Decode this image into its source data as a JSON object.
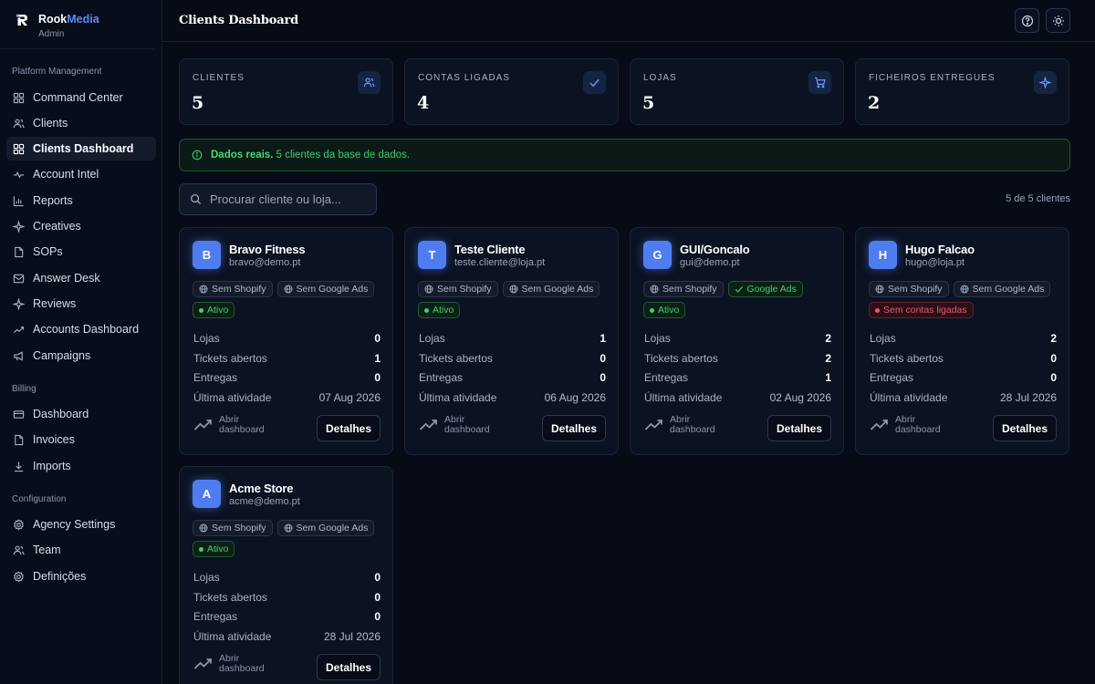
{
  "brand": {
    "name_part1": "Rook",
    "name_part2": "Media",
    "role": "Admin"
  },
  "sidebar": {
    "sections": [
      {
        "label": "Platform Management"
      },
      {
        "label": "Billing"
      },
      {
        "label": "Configuration"
      }
    ],
    "items": [
      {
        "label": "Command Center",
        "icon": "grid-icon"
      },
      {
        "label": "Clients",
        "icon": "users-icon"
      },
      {
        "label": "Clients Dashboard",
        "icon": "grid-icon",
        "active": true
      },
      {
        "label": "Account Intel",
        "icon": "pulse-icon"
      },
      {
        "label": "Reports",
        "icon": "bar-chart-icon"
      },
      {
        "label": "Creatives",
        "icon": "sparkle-icon"
      },
      {
        "label": "SOPs",
        "icon": "document-icon"
      },
      {
        "label": "Answer Desk",
        "icon": "inbox-icon"
      },
      {
        "label": "Reviews",
        "icon": "sparkle-icon"
      },
      {
        "label": "Accounts Dashboard",
        "icon": "trend-icon"
      },
      {
        "label": "Campaigns",
        "icon": "megaphone-icon"
      },
      {
        "label": "Dashboard",
        "icon": "card-icon"
      },
      {
        "label": "Invoices",
        "icon": "document-icon"
      },
      {
        "label": "Imports",
        "icon": "download-icon"
      },
      {
        "label": "Agency Settings",
        "icon": "gear-icon"
      },
      {
        "label": "Team",
        "icon": "users-icon"
      },
      {
        "label": "Definições",
        "icon": "gear-icon"
      }
    ]
  },
  "header": {
    "title": "Clients Dashboard"
  },
  "stats": [
    {
      "label": "CLIENTES",
      "value": "5",
      "icon": "users-icon"
    },
    {
      "label": "CONTAS LIGADAS",
      "value": "4",
      "icon": "check-icon"
    },
    {
      "label": "LOJAS",
      "value": "5",
      "icon": "cart-icon"
    },
    {
      "label": "FICHEIROS ENTREGUES",
      "value": "2",
      "icon": "sparkle-icon"
    }
  ],
  "alert": {
    "bold": "Dados reais.",
    "text": "5 clientes da base de dados."
  },
  "search": {
    "placeholder": "Procurar cliente ou loja..."
  },
  "count": "5 de 5 clientes",
  "labels": {
    "stores": "Lojas",
    "tickets": "Tickets abertos",
    "deliveries": "Entregas",
    "last_activity": "Última atividade",
    "open_dashboard_1": "Abrir",
    "open_dashboard_2": "dashboard",
    "details": "Detalhes"
  },
  "colors": {
    "accent": "#4f7df0",
    "success": "#42d06d",
    "danger": "#f0566a",
    "background": "#060b16"
  },
  "clients": [
    {
      "initial": "B",
      "name": "Bravo Fitness",
      "email": "bravo@demo.pt",
      "shopify": "Sem Shopify",
      "google": "Sem Google Ads",
      "google_connected": false,
      "status": "Ativo",
      "status_type": "ok",
      "stores": "0",
      "tickets": "1",
      "deliveries": "0",
      "last_activity": "07 Aug 2026"
    },
    {
      "initial": "T",
      "name": "Teste Cliente",
      "email": "teste.cliente@loja.pt",
      "shopify": "Sem Shopify",
      "google": "Sem Google Ads",
      "google_connected": false,
      "status": "Ativo",
      "status_type": "ok",
      "stores": "1",
      "tickets": "0",
      "deliveries": "0",
      "last_activity": "06 Aug 2026"
    },
    {
      "initial": "G",
      "name": "GUI/Goncalo",
      "email": "gui@demo.pt",
      "shopify": "Sem Shopify",
      "google": "Google Ads",
      "google_connected": true,
      "status": "Ativo",
      "status_type": "ok",
      "stores": "2",
      "tickets": "2",
      "deliveries": "1",
      "last_activity": "02 Aug 2026"
    },
    {
      "initial": "H",
      "name": "Hugo Falcao",
      "email": "hugo@loja.pt",
      "shopify": "Sem Shopify",
      "google": "Sem Google Ads",
      "google_connected": false,
      "status": "Sem contas ligadas",
      "status_type": "error",
      "stores": "2",
      "tickets": "0",
      "deliveries": "0",
      "last_activity": "28 Jul 2026"
    },
    {
      "initial": "A",
      "name": "Acme Store",
      "email": "acme@demo.pt",
      "shopify": "Sem Shopify",
      "google": "Sem Google Ads",
      "google_connected": false,
      "status": "Ativo",
      "status_type": "ok",
      "stores": "0",
      "tickets": "0",
      "deliveries": "0",
      "last_activity": "28 Jul 2026"
    }
  ]
}
